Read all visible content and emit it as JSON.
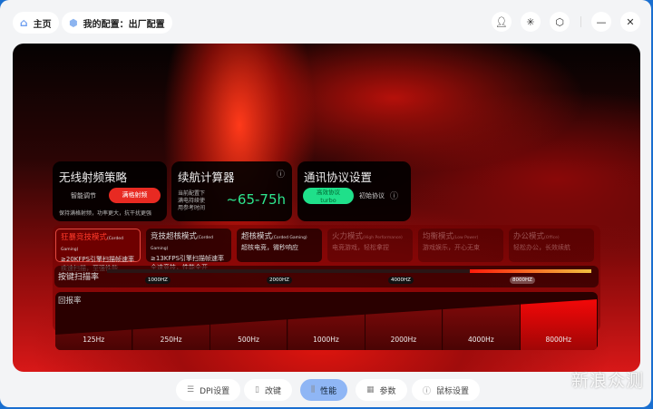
{
  "header": {
    "home": "主页",
    "config": "我的配置：出厂配置"
  },
  "cards": {
    "wireless": {
      "title": "无线射频策略",
      "opt1": "智能调节",
      "opt2": "满格射频",
      "desc": "保持满格射频，功率更大，抗干扰更强"
    },
    "battery": {
      "title": "续航计算器",
      "desc1": "当前配置下",
      "desc2": "满电持续使",
      "desc3": "用参考时间",
      "value": "~65-75h"
    },
    "protocol": {
      "title": "通讯协议设置",
      "opt1a": "高效协议",
      "opt1b": "turbo",
      "opt2": "初始协议"
    }
  },
  "modes": [
    {
      "title": "狂暴竞技模式",
      "en": "(Corded Gaming)",
      "l1": "≥20KFPS引擎扫描帧速率",
      "l2": "疾速扫描，至强性能",
      "selected": true
    },
    {
      "title": "竞技超核模式",
      "en": "(Corded Gaming)",
      "l1": "≥13KFPS引擎扫描帧速率",
      "l2": "全速竞技，性能全开"
    },
    {
      "title": "超核模式",
      "en": "(Corded Gaming)",
      "l1": "超核电竞，微秒响应",
      "l2": ""
    },
    {
      "title": "火力模式",
      "en": "(High Performance)",
      "l1": "电竞游戏，轻松拿捏",
      "l2": "",
      "dim": true
    },
    {
      "title": "均衡模式",
      "en": "(Low Power)",
      "l1": "游戏娱乐，开心无束",
      "l2": "",
      "dim": true
    },
    {
      "title": "办公模式",
      "en": "(Office)",
      "l1": "轻松办公，长效续航",
      "l2": "",
      "dim": true
    }
  ],
  "scan": {
    "label": "按键扫描率",
    "ticks": [
      "1000HZ",
      "2000HZ",
      "4000HZ",
      "8000HZ"
    ],
    "selected": "8000HZ"
  },
  "report": {
    "label": "回报率",
    "rates": [
      "125Hz",
      "250Hz",
      "500Hz",
      "1000Hz",
      "2000Hz",
      "4000Hz",
      "8000Hz"
    ],
    "selected": "8000Hz"
  },
  "nav": [
    "DPI设置",
    "改键",
    "性能",
    "参数",
    "鼠标设置"
  ],
  "nav_active": "性能",
  "watermark": "新浪众测"
}
